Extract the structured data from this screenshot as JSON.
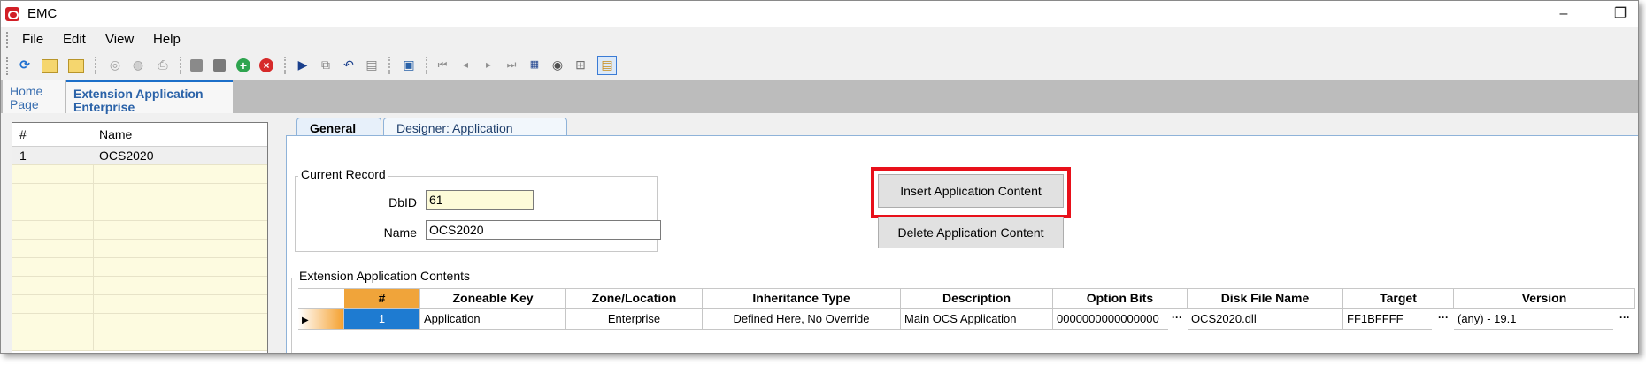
{
  "window": {
    "title": "EMC"
  },
  "menu": [
    "File",
    "Edit",
    "View",
    "Help"
  ],
  "toolbar_icons": [
    "refresh-icon",
    "new-folder-icon",
    "open-folder-icon",
    "disabled-icon",
    "comment-icon",
    "print-icon",
    "save-icon",
    "save-all-icon",
    "add-record-icon",
    "delete-record-icon",
    "play-icon",
    "copy-icon",
    "undo-icon",
    "paste-icon",
    "window-icon",
    "first-record-icon",
    "prev-record-icon",
    "next-record-icon",
    "last-record-icon",
    "calendar-icon",
    "binoculars-icon",
    "import-icon",
    "grid-icon"
  ],
  "doc_tabs": {
    "home": "Home\nPage",
    "extension": "Extension Application\nEnterprise"
  },
  "left_list": {
    "headers": [
      "#",
      "Name"
    ],
    "rows": [
      {
        "num": "1",
        "name": "OCS2020"
      }
    ]
  },
  "tabs": {
    "general": "General",
    "designer": "Designer: Application"
  },
  "current_record": {
    "label": "Current Record",
    "dbid_label": "DbID",
    "dbid_value": "61",
    "name_label": "Name",
    "name_value": "OCS2020"
  },
  "buttons": {
    "insert": "Insert Application Content",
    "delete": "Delete Application Content"
  },
  "contents": {
    "label": "Extension Application Contents",
    "headers": [
      "#",
      "Zoneable Key",
      "Zone/Location",
      "Inheritance Type",
      "Description",
      "Option Bits",
      "Disk File Name",
      "Target",
      "Version"
    ],
    "row": {
      "num": "1",
      "zoneable_key": "Application",
      "zone": "Enterprise",
      "inheritance": "Defined Here, No Override",
      "description": "Main OCS Application",
      "option_bits": "0000000000000000",
      "disk_file": "OCS2020.dll",
      "target": "FF1BFFFF",
      "version": "(any) - 19.1"
    }
  },
  "colors": {
    "highlight": "#e8101a",
    "selected_cell": "#1e7bd1",
    "row_indicator": "#f5a130",
    "list_row": "#fdfbe0"
  }
}
